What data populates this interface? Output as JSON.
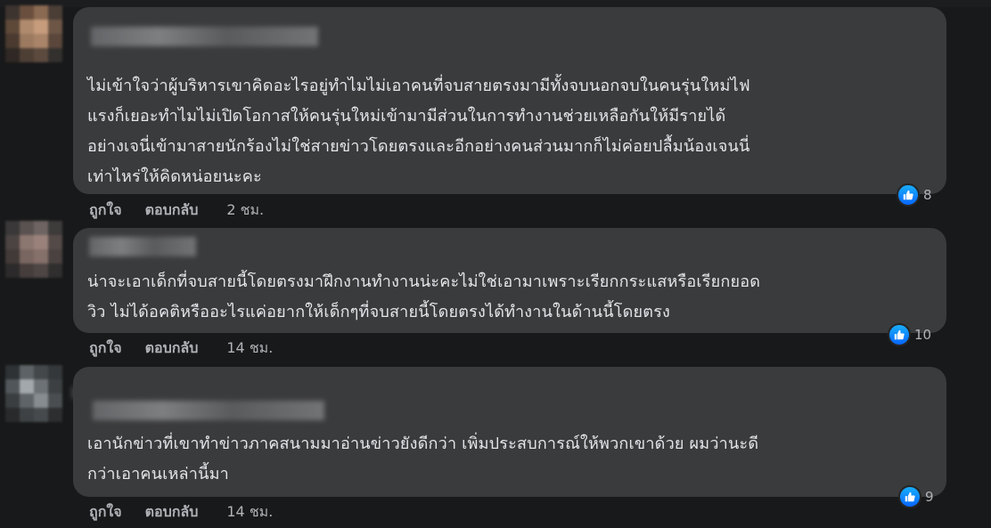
{
  "comments": [
    {
      "text_lines": [
        "ไม่เข้าใจว่าผู้บริหารเขาคิดอะไรอยู่ทำไมไม่เอาคนที่จบสายตรงมามีทั้งจบนอกจบในคนรุ่นใหม่ไฟ",
        "แรงก็เยอะทำไมไม่เปิดโอกาสให้คนรุ่นใหม่เข้ามามีส่วนในการทำงานช่วยเหลือกันให้มีรายได้",
        "อย่างเจนี่เข้ามาสายนักร้องไม่ใช่สายข่าวโดยตรงและอีกอย่างคนส่วนมากก็ไม่ค่อยปลื้มน้องเจนนี่",
        "เท่าไหร่ให้คิดหน่อยนะคะ"
      ],
      "reaction_count": "8",
      "like_label": "ถูกใจ",
      "reply_label": "ตอบกลับ",
      "time": "2 ชม."
    },
    {
      "text_lines": [
        "น่าจะเอาเด็กที่จบสายนี้โดยตรงมาฝึกงานทำงานน่ะคะไม่ใช่เอามาเพราะเรียกกระแสหรือเรียกยอด",
        "วิว ไม่ได้อคติหรืออะไรแค่อยากให้เด็กๆที่จบสายนี้โดยตรงได้ทำงานในด้านนี้โดยตรง"
      ],
      "reaction_count": "10",
      "like_label": "ถูกใจ",
      "reply_label": "ตอบกลับ",
      "time": "14 ชม."
    },
    {
      "text_lines": [
        "เอานักข่าวที่เขาทำข่าวภาคสนามมาอ่านข่าวยังดีกว่า เพิ่มประสบการณ์ให้พวกเขาด้วย ผมว่านะดี",
        "กว่าเอาคนเหล่านี้มา"
      ],
      "reaction_count": "9",
      "like_label": "ถูกใจ",
      "reply_label": "ตอบกลับ",
      "time": "14 ชม."
    }
  ],
  "colors": {
    "background": "#18191a",
    "bubble": "#3a3b3c",
    "text": "#e4e6eb",
    "secondary_text": "#b0b3b8",
    "like_blue": "#0866ff"
  },
  "icons": {
    "like": "thumbs-up-icon"
  }
}
